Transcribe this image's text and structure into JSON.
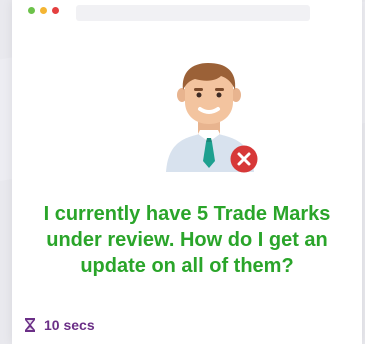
{
  "window": {
    "controls": [
      "green-dot",
      "yellow-dot",
      "red-dot"
    ]
  },
  "card": {
    "question": "I currently have 5 Trade Marks under review. How do I get an update on all of them?",
    "timer_label": "10 secs",
    "timer_icon": "hourglass-icon",
    "avatar_icon": "person-icon",
    "badge_icon": "close-icon"
  },
  "colors": {
    "question_text": "#2aa52a",
    "timer_text": "#6b2f87",
    "badge_red": "#d73838"
  }
}
